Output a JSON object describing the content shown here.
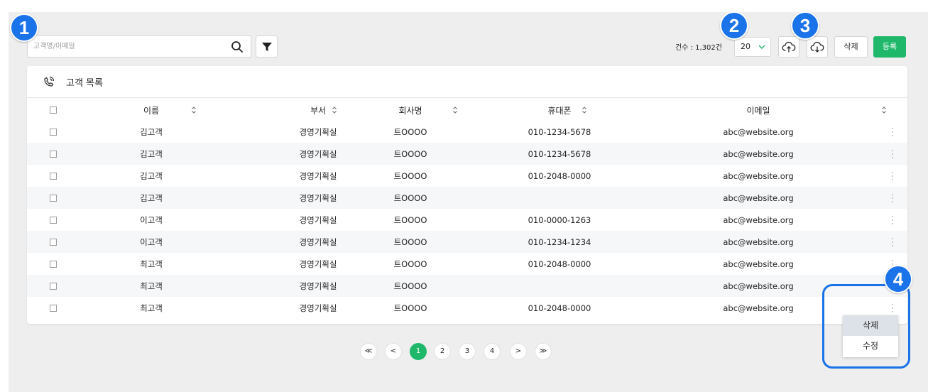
{
  "search": {
    "placeholder": "고객명/이메일"
  },
  "toolbar": {
    "count_label": "건수 : 1,302건",
    "page_size": "20",
    "delete_label": "삭제",
    "register_label": "등록",
    "register_color": "#1fb86b"
  },
  "badges": [
    "1",
    "2",
    "3",
    "4"
  ],
  "card": {
    "title": "고객 목록"
  },
  "columns": {
    "name": "이름",
    "dept": "부서",
    "company": "회사명",
    "phone": "휴대폰",
    "email": "이메일"
  },
  "rows": [
    {
      "name": "김고객",
      "dept": "경영기획실",
      "company": "트OOOO",
      "phone": "010-1234-5678",
      "email": "abc@website.org"
    },
    {
      "name": "김고객",
      "dept": "경영기획실",
      "company": "트OOOO",
      "phone": "010-1234-5678",
      "email": "abc@website.org"
    },
    {
      "name": "김고객",
      "dept": "경영기획실",
      "company": "트OOOO",
      "phone": "010-2048-0000",
      "email": "abc@website.org"
    },
    {
      "name": "김고객",
      "dept": "경영기획실",
      "company": "트OOOO",
      "phone": "",
      "email": "abc@website.org"
    },
    {
      "name": "이고객",
      "dept": "경영기획실",
      "company": "트OOOO",
      "phone": "010-0000-1263",
      "email": "abc@website.org"
    },
    {
      "name": "이고객",
      "dept": "경영기획실",
      "company": "트OOOO",
      "phone": "010-1234-1234",
      "email": "abc@website.org"
    },
    {
      "name": "최고객",
      "dept": "경영기획실",
      "company": "트OOOO",
      "phone": "010-2048-0000",
      "email": "abc@website.org"
    },
    {
      "name": "최고객",
      "dept": "경영기획실",
      "company": "트OOOO",
      "phone": "",
      "email": "abc@website.org"
    },
    {
      "name": "최고객",
      "dept": "경영기획실",
      "company": "트OOOO",
      "phone": "010-2048-0000",
      "email": "abc@website.org"
    }
  ],
  "row_menu": {
    "delete": "삭제",
    "edit": "수정"
  },
  "pagination": {
    "first": "≪",
    "prev": "<",
    "pages": [
      "1",
      "2",
      "3",
      "4"
    ],
    "next": ">",
    "last": "≫",
    "current": "1"
  },
  "colors": {
    "accent_blue": "#1a73e8",
    "green": "#1fb86b"
  }
}
